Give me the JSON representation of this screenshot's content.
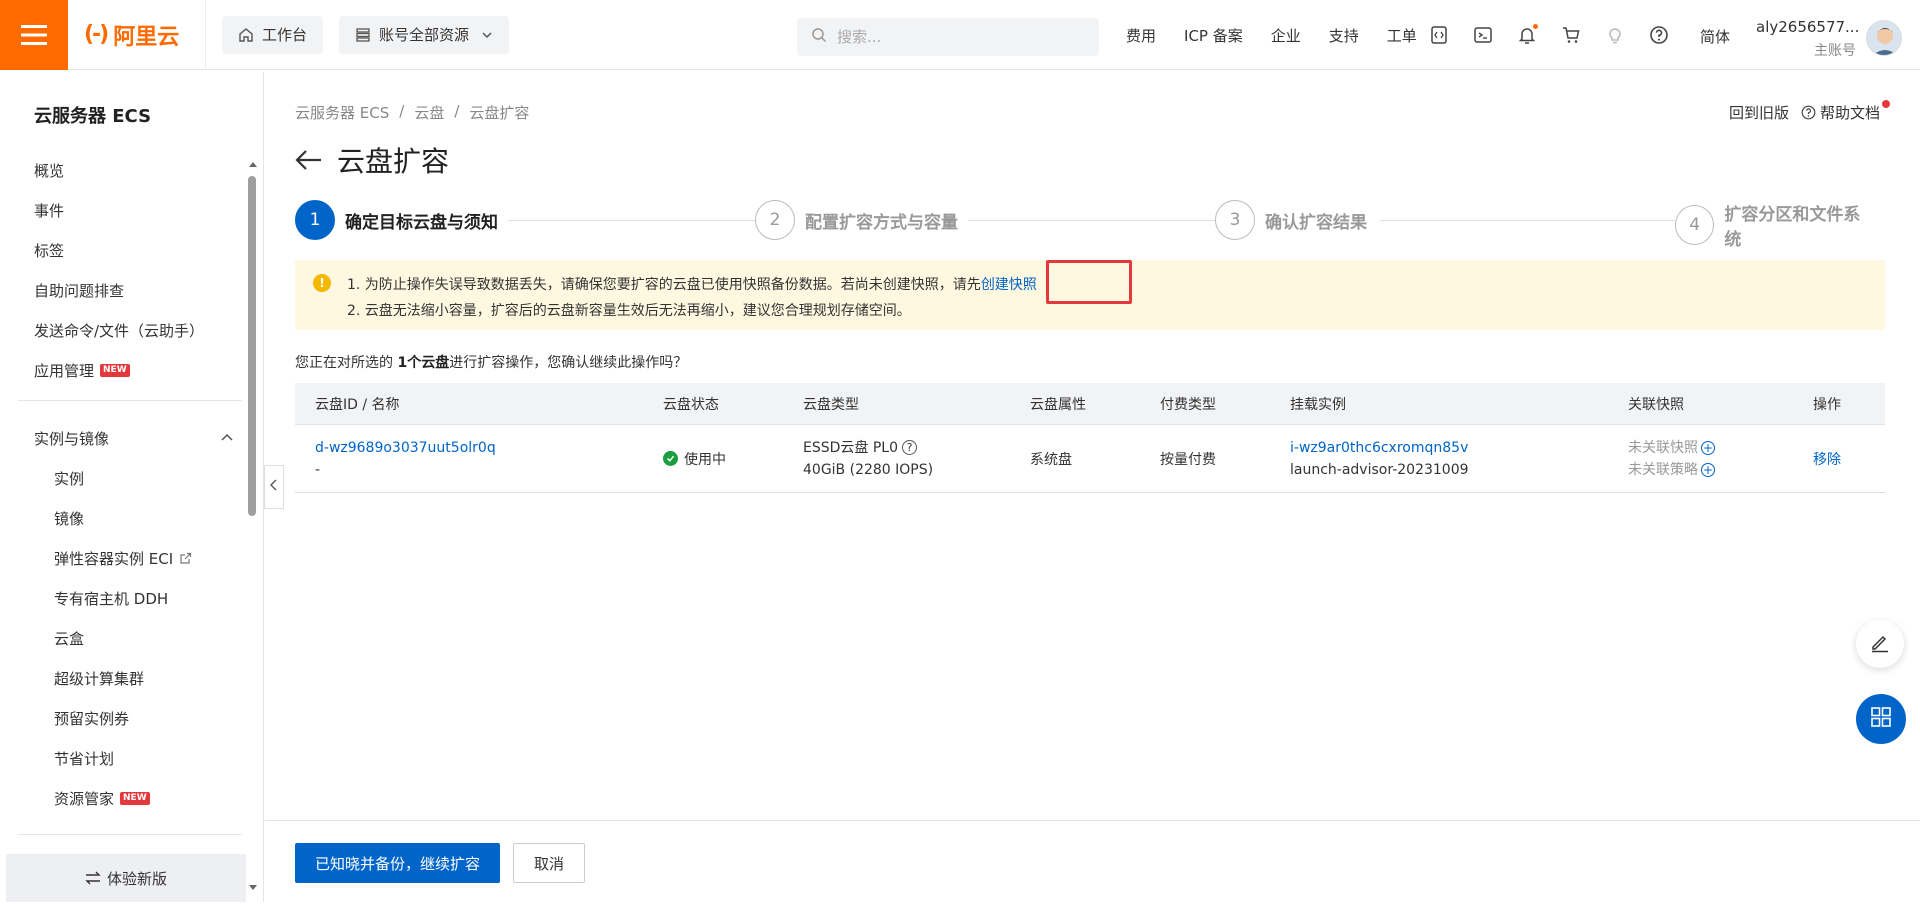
{
  "topbar": {
    "logo_text": "阿里云",
    "workbench": "工作台",
    "resources": "账号全部资源",
    "search_placeholder": "搜索...",
    "links": [
      "费用",
      "ICP 备案",
      "企业",
      "支持",
      "工单"
    ],
    "lang": "简体",
    "username": "aly2656577...",
    "role": "主账号"
  },
  "sidebar": {
    "title": "云服务器 ECS",
    "items": [
      "概览",
      "事件",
      "标签",
      "自助问题排查",
      "发送命令/文件（云助手）",
      "应用管理"
    ],
    "section": "实例与镜像",
    "sub_items": [
      "实例",
      "镜像",
      "弹性容器实例 ECI",
      "专有宿主机 DDH",
      "云盒",
      "超级计算集群",
      "预留实例券",
      "节省计划",
      "资源管家"
    ],
    "new_badge": "NEW",
    "bottom": "体验新版"
  },
  "main": {
    "breadcrumb": [
      "云服务器 ECS",
      "云盘",
      "云盘扩容"
    ],
    "old_version": "回到旧版",
    "help_docs": "帮助文档",
    "title": "云盘扩容",
    "steps": [
      {
        "num": "1",
        "label": "确定目标云盘与须知"
      },
      {
        "num": "2",
        "label": "配置扩容方式与容量"
      },
      {
        "num": "3",
        "label": "确认扩容结果"
      },
      {
        "num": "4",
        "label": "扩容分区和文件系统"
      }
    ],
    "alert": {
      "line1_text": "1. 为防止操作失误导致数据丢失，请确保您要扩容的云盘已使用快照备份数据。若尚未创建快照，请先",
      "line1_link": "创建快照",
      "line2_text": "2. 云盘无法缩小容量，扩容后的云盘新容量生效后无法再缩小，建议您合理规划存储空间。"
    },
    "confirm_prefix": "您正在对所选的 ",
    "confirm_bold": "1个云盘",
    "confirm_suffix": "进行扩容操作，您确认继续此操作吗？",
    "table": {
      "headers": [
        "云盘ID / 名称",
        "云盘状态",
        "云盘类型",
        "云盘属性",
        "付费类型",
        "挂载实例",
        "关联快照",
        "操作"
      ],
      "row": {
        "disk_id": "d-wz9689o3037uut5olr0q",
        "disk_name": "-",
        "status": "使用中",
        "type_line1": "ESSD云盘 PL0",
        "type_line2": "40GiB (2280 IOPS)",
        "attribute": "系统盘",
        "billing": "按量付费",
        "instance_id": "i-wz9ar0thc6cxromqn85v",
        "instance_name": "launch-advisor-20231009",
        "snapshot1": "未关联快照",
        "snapshot2": "未关联策略",
        "action": "移除"
      }
    },
    "btn_continue": "已知晓并备份，继续扩容",
    "btn_cancel": "取消"
  }
}
